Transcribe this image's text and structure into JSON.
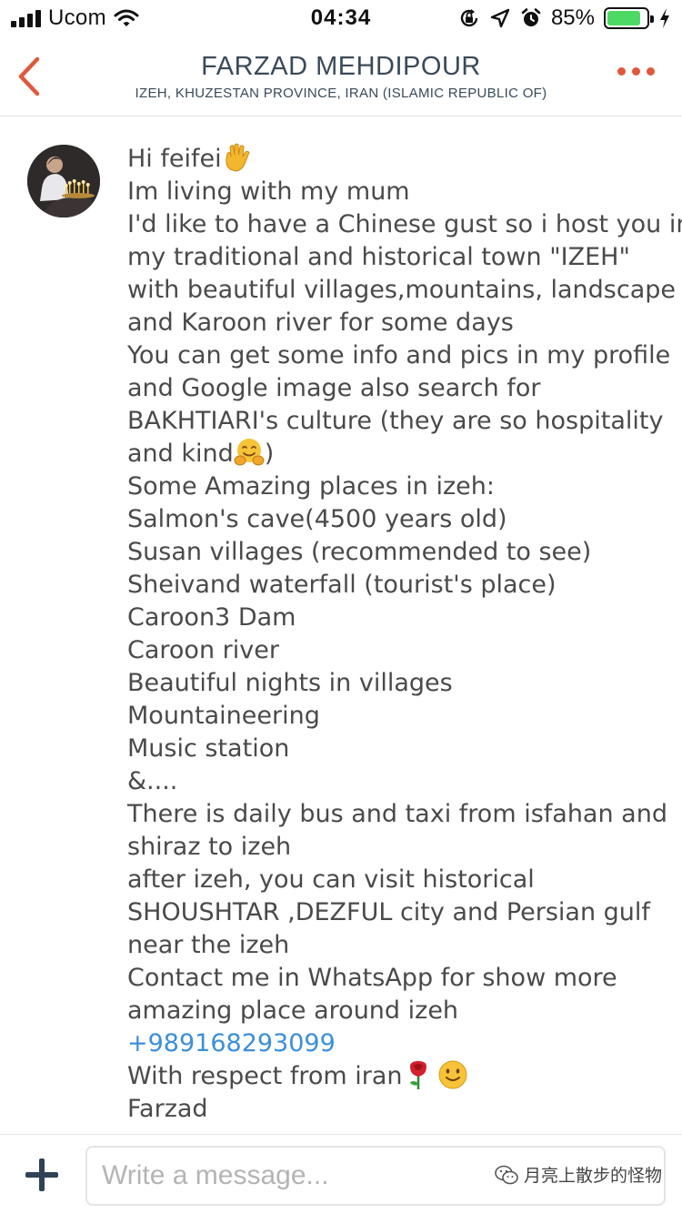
{
  "status_bar": {
    "carrier": "Ucom",
    "time": "04:34",
    "battery_percent": "85%",
    "battery_level": 0.85,
    "icons": [
      "signal-icon",
      "wifi-icon",
      "orientation-lock-icon",
      "location-icon",
      "alarm-icon",
      "battery-icon",
      "charging-icon"
    ]
  },
  "header": {
    "title": "FARZAD MEHDIPOUR",
    "subtitle": "IZEH, KHUZESTAN PROVINCE, IRAN (ISLAMIC REPUBLIC OF)",
    "back_icon": "chevron-left-icon",
    "more_icon": "more-horizontal-icon"
  },
  "colors": {
    "accent": "#e0583a",
    "header_text": "#3a4a5a",
    "message_text": "#4a4a4a",
    "link": "#3c8fd8",
    "compose_plus": "#2f4257"
  },
  "message": {
    "greeting": "Hi feifei",
    "lines": [
      "Im living with my mum",
      "I'd like to have a Chinese gust so i host you in",
      "my traditional and historical town \"IZEH\"",
      "with beautiful villages,mountains, landscape",
      "and Karoon river for some days",
      "You can get some info and pics in my profile",
      "and Google image also search for",
      "BAKHTIARI's culture (they are so hospitality"
    ],
    "kind_line_start": "and kind",
    "kind_line_end": ")",
    "lines2": [
      "Some Amazing places in izeh:",
      "Salmon's cave(4500 years old)",
      "Susan villages (recommended to see)",
      "Sheivand waterfall (tourist's place)",
      "Caroon3 Dam",
      "Caroon river",
      "Beautiful nights in villages",
      "Mountaineering",
      "Music station",
      "&....",
      "There is daily bus and taxi from isfahan and",
      "shiraz to izeh",
      "after izeh, you can visit  historical",
      "SHOUSHTAR ,DEZFUL city and Persian gulf",
      "near the izeh",
      "Contact me in WhatsApp for show more",
      "amazing place around izeh"
    ],
    "phone": "+989168293099",
    "closing": "With respect from iran",
    "signature": "Farzad",
    "emojis": [
      "waving-hand-icon",
      "hugging-face-icon",
      "rose-icon",
      "smiling-face-icon"
    ]
  },
  "composer": {
    "plus_icon": "plus-icon",
    "placeholder": "Write a message..."
  },
  "watermark": {
    "text": "月亮上散步的怪物",
    "icon": "wechat-icon"
  }
}
